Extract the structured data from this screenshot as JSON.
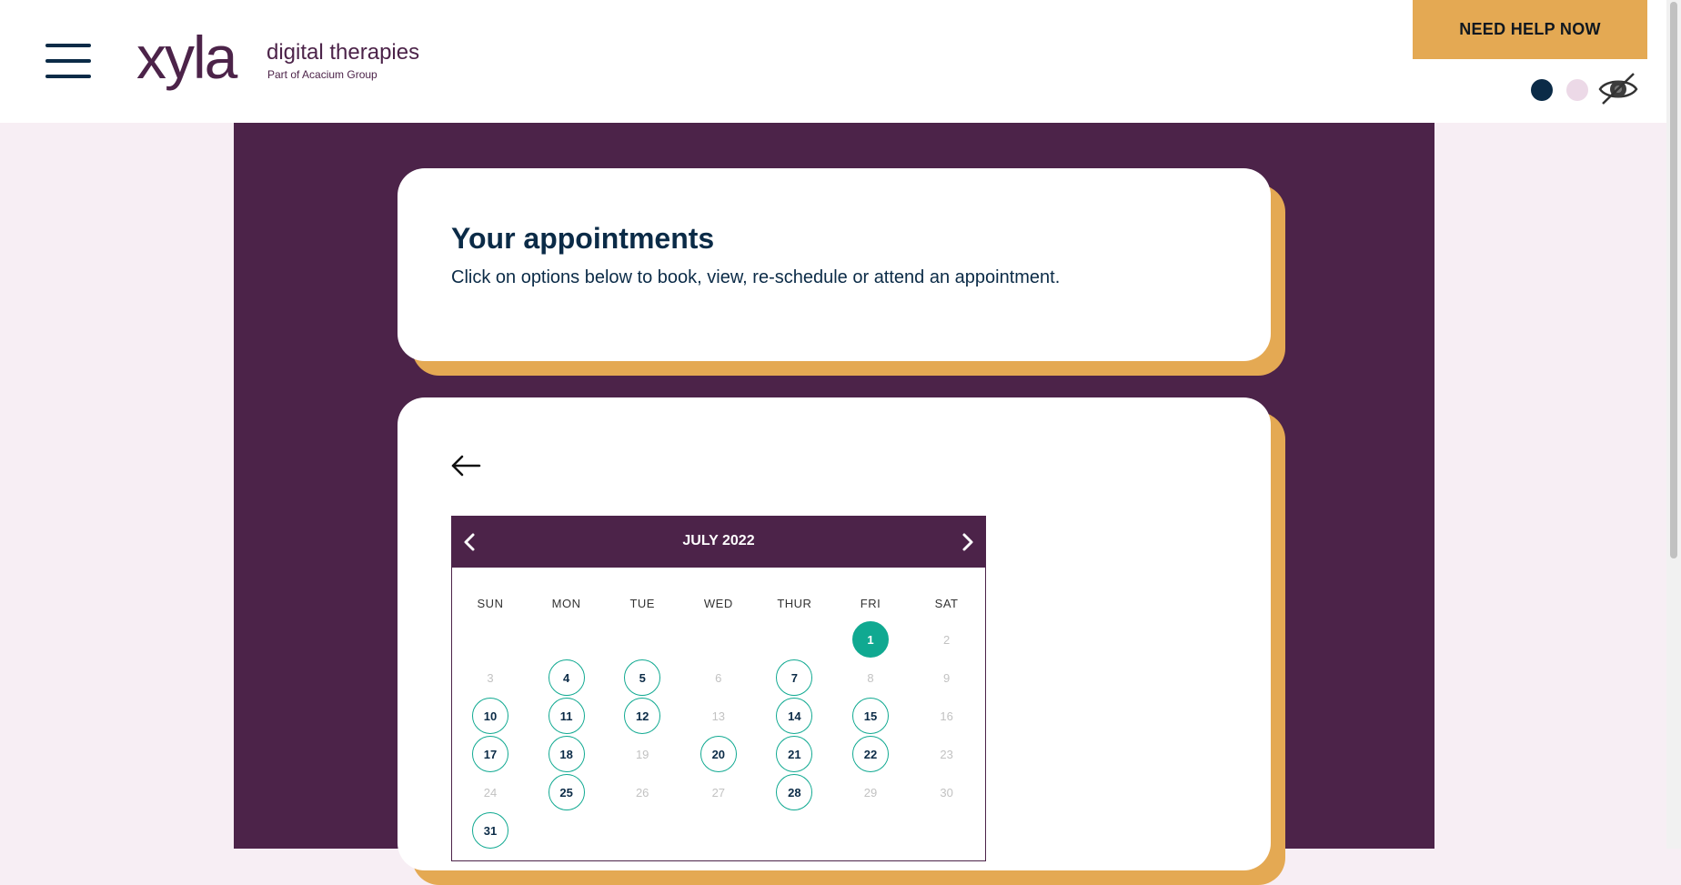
{
  "header": {
    "logo_word": "xyla",
    "logo_tagline": "digital therapies",
    "logo_sub": "Part of Acacium Group",
    "help_button": "NEED HELP NOW"
  },
  "colors": {
    "brand_purple": "#4c2349",
    "accent_gold": "#e4a953",
    "navy": "#0b2b47",
    "available_teal": "#10a991",
    "page_pink": "#f7eef4"
  },
  "icons": {
    "menu": "hamburger-icon",
    "back": "arrow-left-icon",
    "prev": "chevron-left-icon",
    "next": "chevron-right-icon",
    "contrast": "eye-slash-icon"
  },
  "intro": {
    "title": "Your appointments",
    "subtitle": "Click on options below to book, view, re-schedule or attend an appointment."
  },
  "calendar": {
    "month": "JULY 2022",
    "weekdays": [
      "SUN",
      "MON",
      "TUE",
      "WED",
      "THUR",
      "FRI",
      "SAT"
    ],
    "weeks": [
      [
        null,
        null,
        null,
        null,
        null,
        {
          "day": "1",
          "state": "selected"
        },
        {
          "day": "2",
          "state": "disabled"
        }
      ],
      [
        {
          "day": "3",
          "state": "disabled"
        },
        {
          "day": "4",
          "state": "available"
        },
        {
          "day": "5",
          "state": "available"
        },
        {
          "day": "6",
          "state": "disabled"
        },
        {
          "day": "7",
          "state": "available"
        },
        {
          "day": "8",
          "state": "disabled"
        },
        {
          "day": "9",
          "state": "disabled"
        }
      ],
      [
        {
          "day": "10",
          "state": "available"
        },
        {
          "day": "11",
          "state": "available"
        },
        {
          "day": "12",
          "state": "available"
        },
        {
          "day": "13",
          "state": "disabled"
        },
        {
          "day": "14",
          "state": "available"
        },
        {
          "day": "15",
          "state": "available"
        },
        {
          "day": "16",
          "state": "disabled"
        }
      ],
      [
        {
          "day": "17",
          "state": "available"
        },
        {
          "day": "18",
          "state": "available"
        },
        {
          "day": "19",
          "state": "disabled"
        },
        {
          "day": "20",
          "state": "available"
        },
        {
          "day": "21",
          "state": "available"
        },
        {
          "day": "22",
          "state": "available"
        },
        {
          "day": "23",
          "state": "disabled"
        }
      ],
      [
        {
          "day": "24",
          "state": "disabled"
        },
        {
          "day": "25",
          "state": "available"
        },
        {
          "day": "26",
          "state": "disabled"
        },
        {
          "day": "27",
          "state": "disabled"
        },
        {
          "day": "28",
          "state": "available"
        },
        {
          "day": "29",
          "state": "disabled"
        },
        {
          "day": "30",
          "state": "disabled"
        }
      ],
      [
        {
          "day": "31",
          "state": "available"
        },
        null,
        null,
        null,
        null,
        null,
        null
      ]
    ]
  }
}
